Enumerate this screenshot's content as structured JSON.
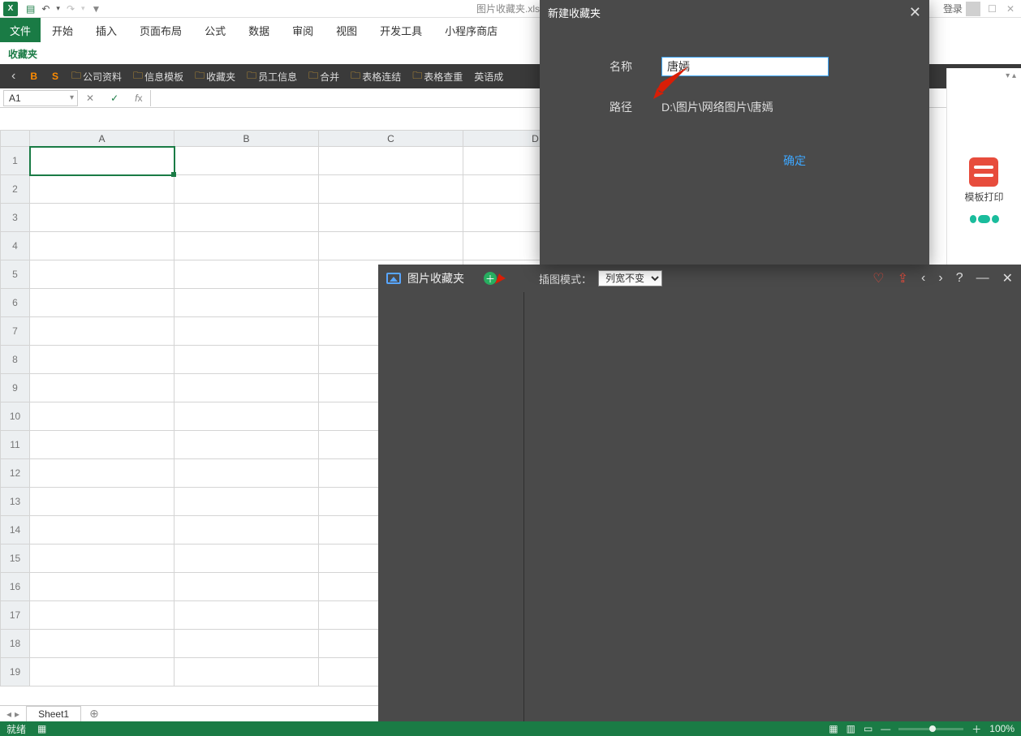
{
  "title_doc": "图片收藏夹.xlsx",
  "login_label": "登录",
  "menu": {
    "file": "文件",
    "items": [
      "开始",
      "插入",
      "页面布局",
      "公式",
      "数据",
      "审阅",
      "视图",
      "开发工具",
      "小程序商店"
    ]
  },
  "ribbon_group": "收藏夹",
  "folderbar": {
    "letters": [
      "B",
      "S"
    ],
    "items": [
      "公司资料",
      "信息模板",
      "收藏夹",
      "员工信息",
      "合并",
      "表格连结",
      "表格查重"
    ],
    "trailing": "英语成"
  },
  "namebox": "A1",
  "columns": [
    "A",
    "B",
    "C",
    "D"
  ],
  "rows": [
    1,
    2,
    3,
    4,
    5,
    6,
    7,
    8,
    9,
    10,
    11,
    12,
    13,
    14,
    15,
    16,
    17,
    18,
    19
  ],
  "sheet_tab": "Sheet1",
  "statusbar": {
    "ready": "就绪",
    "zoom": "100%"
  },
  "right_panel": {
    "print": "模板打印"
  },
  "dialog": {
    "title": "新建收藏夹",
    "name_label": "名称",
    "name_value": "唐嫣",
    "path_label": "路径",
    "path_value": "D:\\图片\\网络图片\\唐嫣",
    "ok": "确定"
  },
  "img_panel": {
    "title": "图片收藏夹",
    "mode_label": "插图模式：",
    "mode_value": "列宽不变"
  }
}
